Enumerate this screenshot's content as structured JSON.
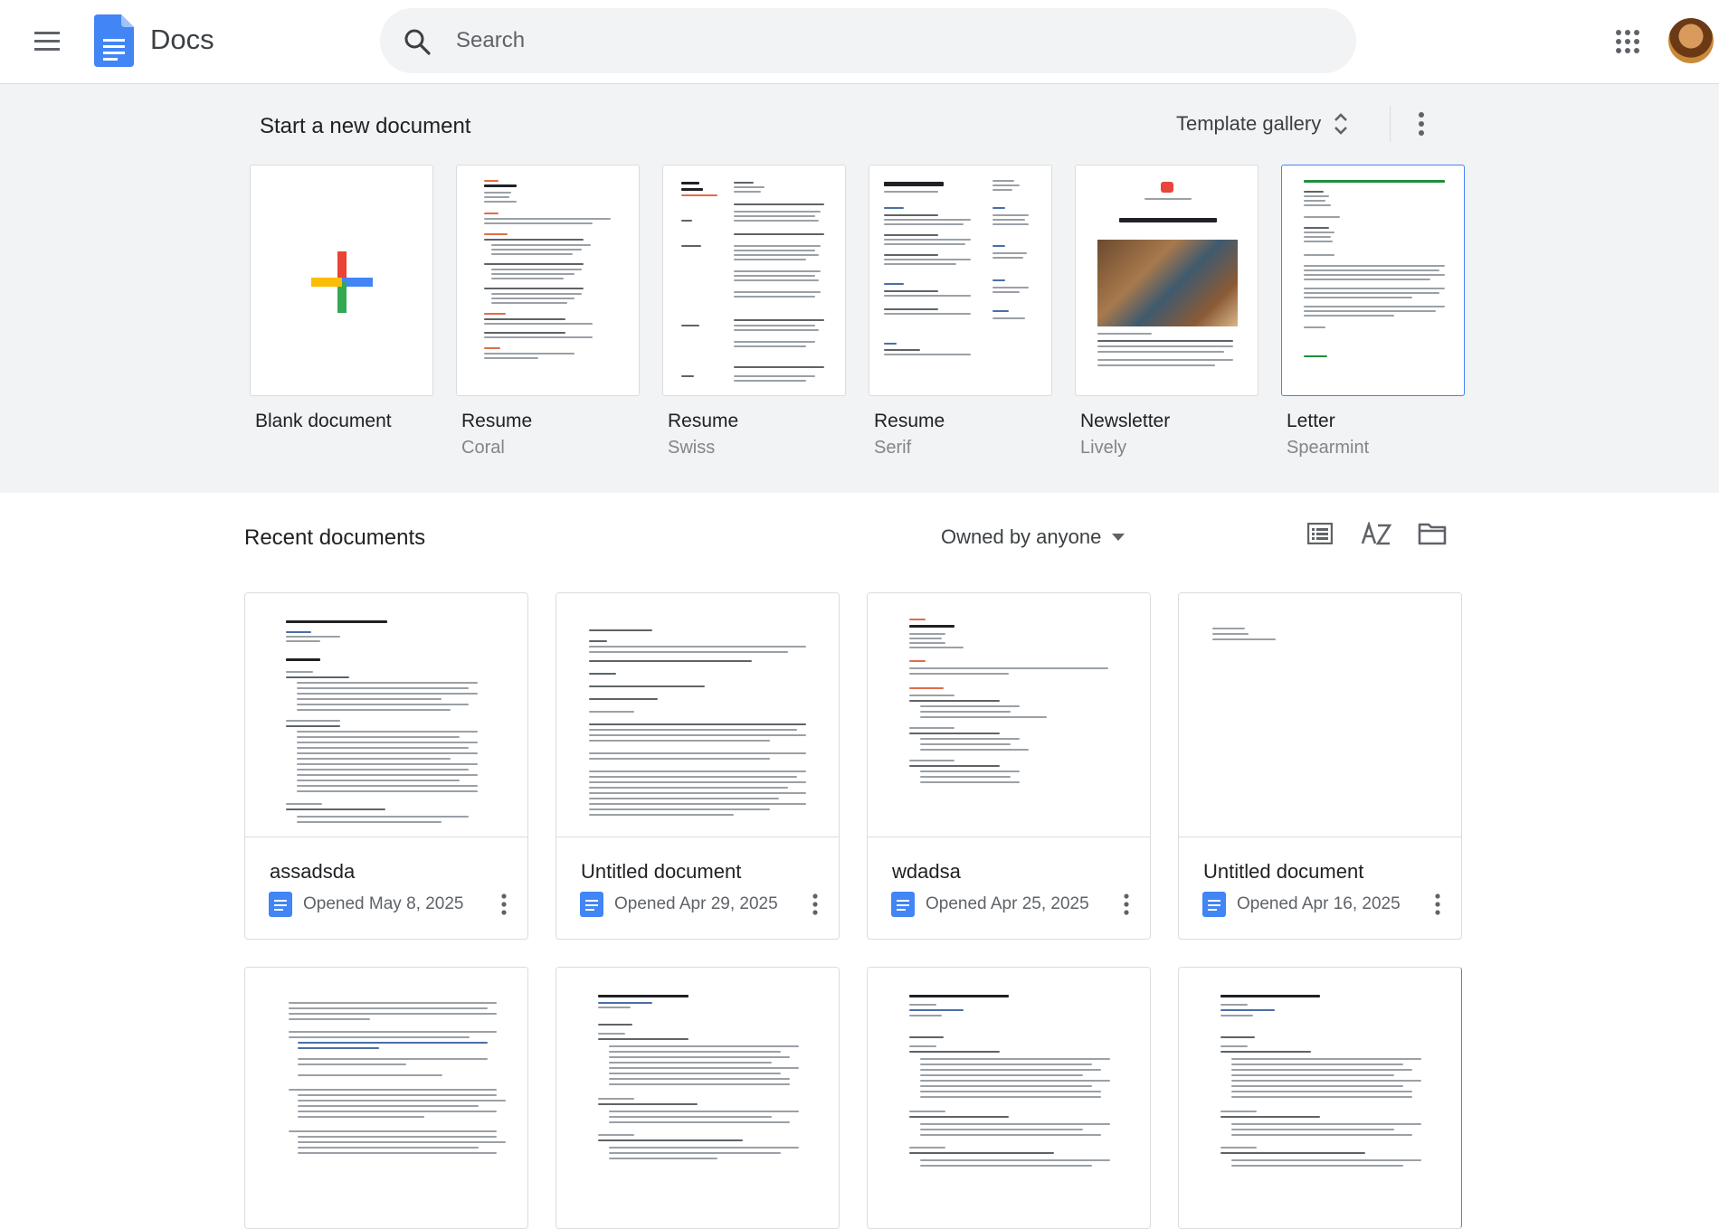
{
  "app": {
    "name": "Docs"
  },
  "search": {
    "placeholder": "Search"
  },
  "templates": {
    "heading": "Start a new document",
    "gallery_label": "Template gallery",
    "items": [
      {
        "title": "Blank document",
        "subtitle": ""
      },
      {
        "title": "Resume",
        "subtitle": "Coral"
      },
      {
        "title": "Resume",
        "subtitle": "Swiss"
      },
      {
        "title": "Resume",
        "subtitle": "Serif"
      },
      {
        "title": "Newsletter",
        "subtitle": "Lively"
      },
      {
        "title": "Letter",
        "subtitle": "Spearmint"
      }
    ]
  },
  "recent": {
    "heading": "Recent documents",
    "owner_filter": "Owned by anyone",
    "docs": [
      {
        "title": "assadsda",
        "opened": "Opened May 8, 2025"
      },
      {
        "title": "Untitled document",
        "opened": "Opened Apr 29, 2025"
      },
      {
        "title": "wdadsa",
        "opened": "Opened Apr 25, 2025"
      },
      {
        "title": "Untitled document",
        "opened": "Opened Apr 16, 2025"
      }
    ]
  },
  "colors": {
    "docs_blue": "#4285f4",
    "band_bg": "#f1f3f4",
    "text_secondary": "#5f6368"
  },
  "icons": [
    "menu-icon",
    "docs-logo-icon",
    "search-icon",
    "apps-grid-icon",
    "unfold-icon",
    "more-vert-icon",
    "list-view-icon",
    "sort-az-icon",
    "folder-icon",
    "doc-file-icon",
    "dropdown-arrow-icon"
  ]
}
